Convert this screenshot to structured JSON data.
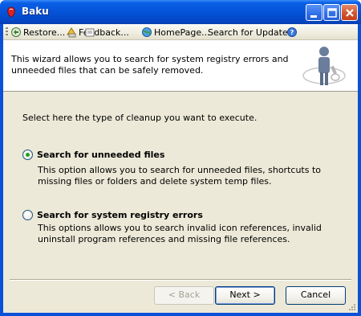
{
  "window": {
    "title": "Baku"
  },
  "toolbar": {
    "items": [
      {
        "label": "Restore...",
        "icon": "restore-icon"
      },
      {
        "label": "Feedback...",
        "icon": "feedback-icon"
      },
      {
        "label": "HomePage...",
        "icon": "homepage-icon"
      },
      {
        "label": "Search for Update...",
        "icon": ""
      },
      {
        "label": "",
        "icon": "help-icon"
      }
    ]
  },
  "header": {
    "text": "This wizard allows you to search for system registry errors and unneeded files that can be safely removed."
  },
  "main": {
    "intro": "Select here the type of cleanup you want to execute.",
    "options": [
      {
        "label": "Search for unneeded files",
        "description": "This option allows you to search for unneeded files, shortcuts to missing files or folders and delete system temp files.",
        "selected": true
      },
      {
        "label": "Search for system registry errors",
        "description": "This options allows you to search invalid icon references, invalid uninstall program references and missing file references.",
        "selected": false
      }
    ]
  },
  "buttons": {
    "back": "< Back",
    "next": "Next >",
    "cancel": "Cancel"
  },
  "colors": {
    "titlebar": "#0553d8",
    "dialog_bg": "#ece9d8",
    "radio_dot": "#21a121"
  }
}
